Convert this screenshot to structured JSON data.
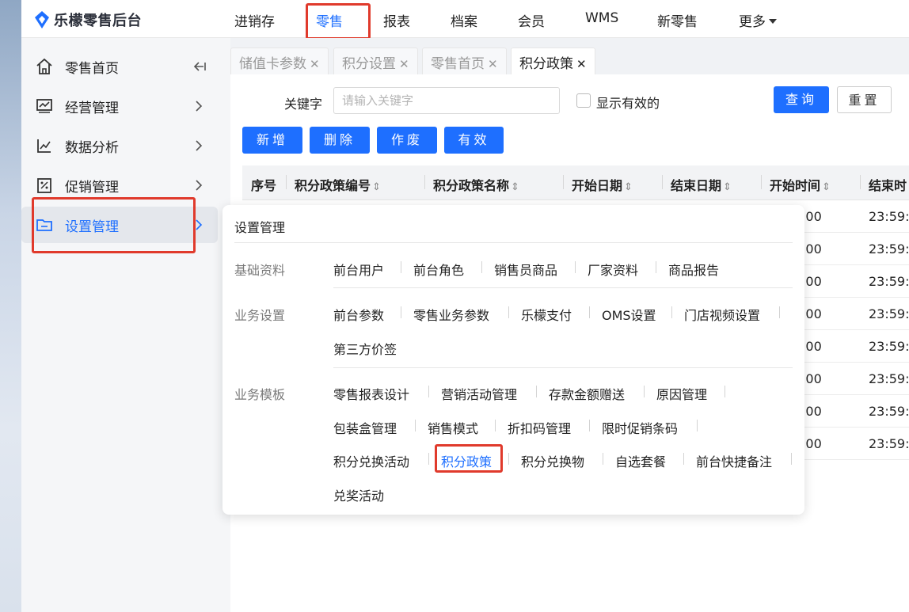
{
  "app": {
    "title": "乐檬零售后台"
  },
  "topnav": [
    {
      "label": "进销存",
      "active": false
    },
    {
      "label": "零售",
      "active": true
    },
    {
      "label": "报表",
      "active": false
    },
    {
      "label": "档案",
      "active": false
    },
    {
      "label": "会员",
      "active": false
    },
    {
      "label": "WMS",
      "active": false
    },
    {
      "label": "新零售",
      "active": false
    },
    {
      "label": "更多",
      "active": false
    }
  ],
  "sidebar": {
    "items": [
      {
        "label": "零售首页",
        "icon": "home-icon"
      },
      {
        "label": "经营管理",
        "icon": "monitor-icon"
      },
      {
        "label": "数据分析",
        "icon": "line-chart-icon"
      },
      {
        "label": "促销管理",
        "icon": "discount-icon"
      },
      {
        "label": "设置管理",
        "icon": "folder-icon",
        "active": true
      }
    ]
  },
  "tabs": [
    {
      "label": "储值卡参数",
      "active": false
    },
    {
      "label": "积分设置",
      "active": false
    },
    {
      "label": "零售首页",
      "active": false
    },
    {
      "label": "积分政策",
      "active": true
    }
  ],
  "filter": {
    "keyword_label": "关键字",
    "keyword_placeholder": "请输入关键字",
    "keyword_value": "",
    "show_valid_label": "显示有效的",
    "show_valid_checked": false,
    "query_label": "查询",
    "reset_label": "重置"
  },
  "actions": {
    "add_label": "新增",
    "delete_label": "删除",
    "void_label": "作废",
    "valid_label": "有效"
  },
  "table": {
    "columns": [
      "序号",
      "积分政策编号",
      "积分政策名称",
      "开始日期",
      "结束日期",
      "开始时间",
      "结束时"
    ],
    "rows": [
      {
        "start_time": ":00",
        "end_time": "23:59:5"
      },
      {
        "start_time": ":00",
        "end_time": "23:59:5"
      },
      {
        "start_time": ":00",
        "end_time": "23:59:5"
      },
      {
        "start_time": ":00",
        "end_time": "23:59:5"
      },
      {
        "start_time": ":00",
        "end_time": "23:59:5"
      },
      {
        "start_time": ":00",
        "end_time": "23:59:5"
      },
      {
        "start_time": ":00",
        "end_time": "23:59:5"
      },
      {
        "start_time": ":00",
        "end_time": "23:59:5"
      }
    ]
  },
  "menu": {
    "title": "设置管理",
    "groups": [
      {
        "label": "基础资料",
        "items": [
          "前台用户",
          "前台角色",
          "销售员商品",
          "厂家资料",
          "商品报告"
        ]
      },
      {
        "label": "业务设置",
        "items": [
          "前台参数",
          "零售业务参数",
          "乐檬支付",
          "OMS设置",
          "门店视频设置",
          "第三方价签"
        ]
      },
      {
        "label": "业务模板",
        "items": [
          "零售报表设计",
          "营销活动管理",
          "存款金额赠送",
          "原因管理",
          "包装盒管理",
          "销售模式",
          "折扣码管理",
          "限时促销条码",
          "积分兑换活动",
          "积分政策",
          "积分兑换物",
          "自选套餐",
          "前台快捷备注",
          "兑奖活动"
        ]
      }
    ],
    "active_item": "积分政策"
  },
  "colors": {
    "accent": "#1e6fff",
    "highlight": "#e03a2c"
  }
}
